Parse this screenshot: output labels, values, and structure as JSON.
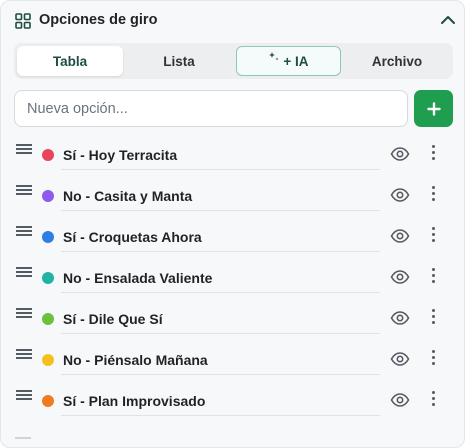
{
  "header": {
    "title": "Opciones de giro",
    "icon": "grid-icon",
    "collapse_icon": "chevron-up-icon"
  },
  "tabs": [
    {
      "label": "Tabla",
      "active": true
    },
    {
      "label": "Lista",
      "active": false
    },
    {
      "label": "+ IA",
      "icon": "sparkle-icon",
      "active": false
    },
    {
      "label": "Archivo",
      "active": false
    }
  ],
  "new_option": {
    "placeholder": "Nueva opción...",
    "value": "",
    "add_icon": "plus-icon"
  },
  "colors": {
    "accent_green": "#1f9e4f",
    "tab_text_active": "#1d4d43"
  },
  "options": [
    {
      "label": "Sí - Hoy Terracita",
      "color": "#e8455c"
    },
    {
      "label": "No - Casita y Manta",
      "color": "#8e5bea"
    },
    {
      "label": "Sí - Croquetas Ahora",
      "color": "#2f7ee6"
    },
    {
      "label": "No - Ensalada Valiente",
      "color": "#22b3a4"
    },
    {
      "label": "Sí - Dile Que Sí",
      "color": "#6cc13c"
    },
    {
      "label": "No - Piénsalo Mañana",
      "color": "#f4c21d"
    },
    {
      "label": "Sí - Plan Improvisado",
      "color": "#f27b22"
    }
  ]
}
